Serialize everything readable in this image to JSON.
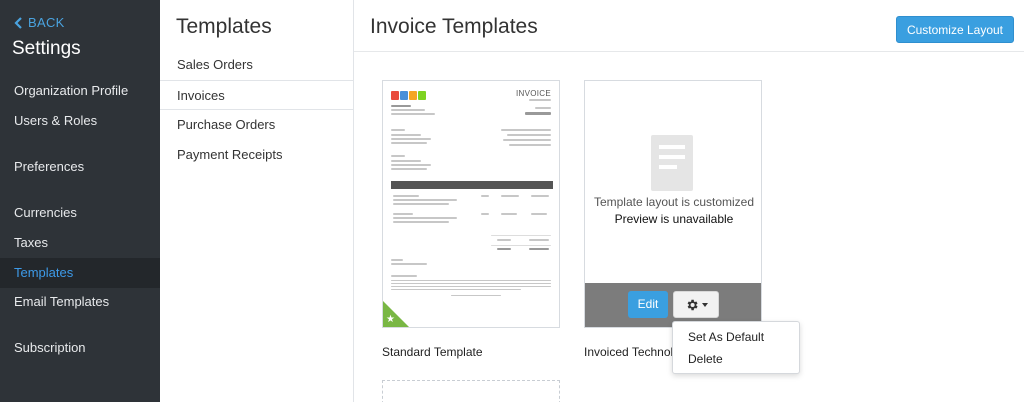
{
  "nav": {
    "back_label": "BACK",
    "title": "Settings",
    "items": [
      {
        "label": "Organization Profile"
      },
      {
        "label": "Users & Roles"
      },
      {
        "label": "Preferences"
      },
      {
        "label": "Currencies"
      },
      {
        "label": "Taxes"
      },
      {
        "label": "Templates"
      },
      {
        "label": "Email Templates"
      },
      {
        "label": "Subscription"
      }
    ],
    "active": "Templates"
  },
  "sub": {
    "title": "Templates",
    "items": [
      {
        "label": "Sales Orders"
      },
      {
        "label": "Invoices"
      },
      {
        "label": "Purchase Orders"
      },
      {
        "label": "Payment Receipts"
      }
    ],
    "active": "Invoices"
  },
  "main": {
    "title": "Invoice Templates",
    "customize_button": "Customize Layout",
    "cards": [
      {
        "caption": "Standard Template",
        "preview_heading": "INVOICE",
        "default_icon": "star-icon"
      },
      {
        "caption": "Invoiced Technol",
        "preview_line1": "Template layout is customized",
        "preview_line2": "Preview is unavailable",
        "edit_button": "Edit",
        "gear_icon": "gear-icon"
      }
    ]
  },
  "dropdown": {
    "items": [
      "Set As Default",
      "Delete"
    ]
  },
  "colors": {
    "accent": "#3a9fe0",
    "nav_bg": "#2e3338",
    "default_badge": "#79b744"
  }
}
